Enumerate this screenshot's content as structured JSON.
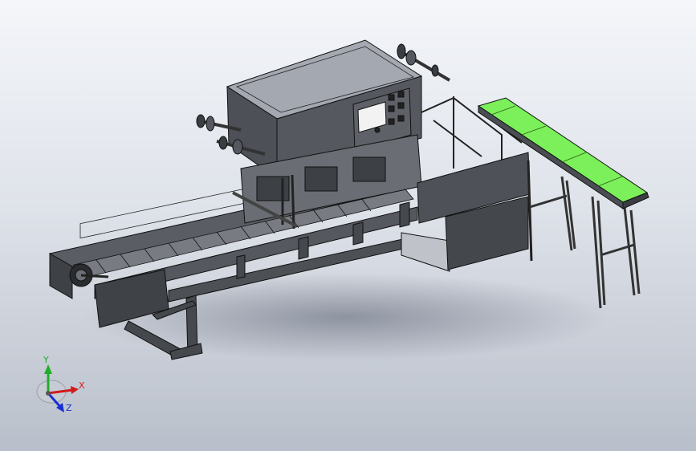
{
  "app": {
    "title": ""
  },
  "viewport": {
    "model": {
      "parts": [
        "frame-rail-front",
        "frame-rail-back",
        "tray-chain",
        "sealing-head-cabinet",
        "control-panel",
        "film-roll-left",
        "film-roll-top",
        "mold-station",
        "lower-cabinet",
        "support-legs",
        "outfeed-conveyor"
      ],
      "colors": {
        "steel_dark": "#4a4d52",
        "steel_mid": "#6e7177",
        "steel_light": "#9a9ea6",
        "outline": "#111111",
        "outfeed_belt": "#7cf05a",
        "panel_face": "#f2f2f2"
      }
    },
    "triad": {
      "y_label": "Y",
      "x_label": "X",
      "z_label": "Z",
      "colors": {
        "x": "#d11a1a",
        "y": "#1fae2a",
        "z": "#1a2fd1"
      }
    }
  }
}
